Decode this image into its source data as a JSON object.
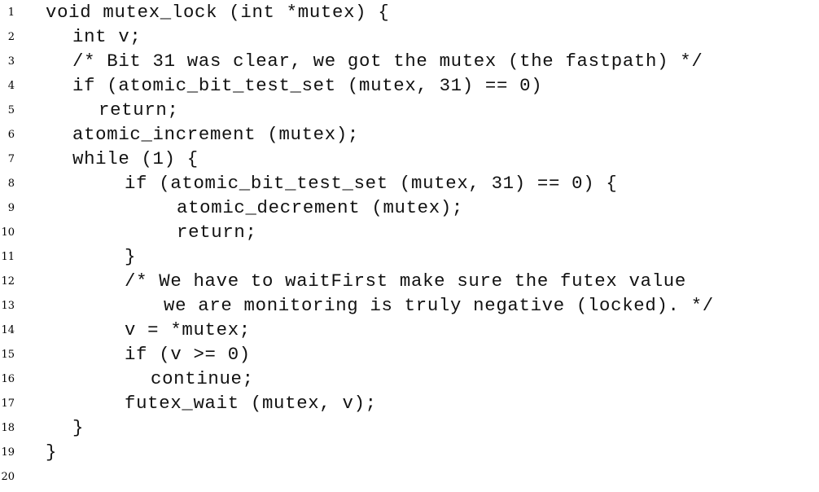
{
  "lines": [
    {
      "num": "1",
      "text": "void mutex_lock (int *mutex) {"
    },
    {
      "num": "2",
      "text": "int v;"
    },
    {
      "num": "3",
      "text": "/* Bit 31 was clear, we got the mutex (the fastpath) */"
    },
    {
      "num": "4",
      "text": "if (atomic_bit_test_set (mutex, 31) == 0)"
    },
    {
      "num": "5",
      "text": "return;"
    },
    {
      "num": "6",
      "text": "atomic_increment (mutex);"
    },
    {
      "num": "7",
      "text": "while (1) {"
    },
    {
      "num": "8",
      "text": "if (atomic_bit_test_set (mutex, 31) == 0) {"
    },
    {
      "num": "9",
      "text": "atomic_decrement (mutex);"
    },
    {
      "num": "10",
      "text": "return;"
    },
    {
      "num": "11",
      "text": "}"
    },
    {
      "num": "12",
      "text": "/* We have to waitFirst make sure the futex value"
    },
    {
      "num": "13",
      "text": "we are monitoring is truly negative (locked). */"
    },
    {
      "num": "14",
      "text": "v = *mutex;"
    },
    {
      "num": "15",
      "text": "if (v >= 0)"
    },
    {
      "num": "16",
      "text": "continue;"
    },
    {
      "num": "17",
      "text": "futex_wait (mutex, v);"
    },
    {
      "num": "18",
      "text": "}"
    },
    {
      "num": "19",
      "text": "}"
    },
    {
      "num": "20",
      "text": ""
    }
  ]
}
